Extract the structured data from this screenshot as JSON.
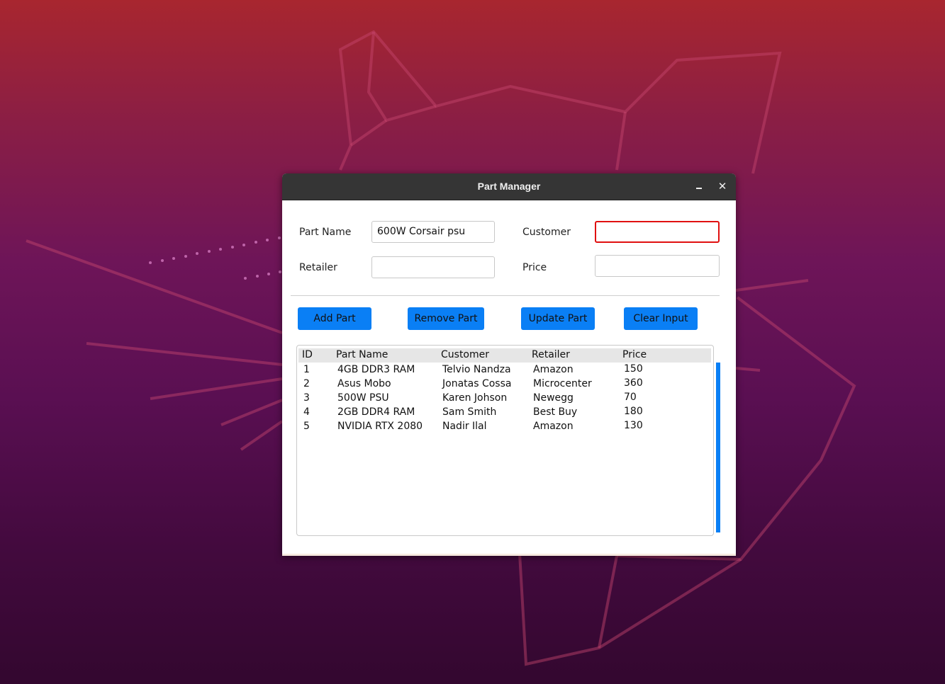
{
  "window": {
    "title": "Part Manager",
    "minimize_glyph": "_",
    "close_glyph": "✕"
  },
  "form": {
    "part_name": {
      "label": "Part Name",
      "value": "600W Corsair psu"
    },
    "customer": {
      "label": "Customer",
      "value": "",
      "error": true,
      "error_color": "#e01010"
    },
    "retailer": {
      "label": "Retailer",
      "value": ""
    },
    "price": {
      "label": "Price",
      "value": ""
    }
  },
  "buttons": {
    "add": "Add Part",
    "remove": "Remove Part",
    "update": "Update Part",
    "clear": "Clear Input",
    "color": "#0a7ff5"
  },
  "table": {
    "columns": [
      "ID",
      "Part Name",
      "Customer",
      "Retailer",
      "Price"
    ],
    "rows": [
      [
        "1",
        "4GB DDR3 RAM",
        "Telvio Nandza",
        "Amazon",
        "150"
      ],
      [
        "2",
        "Asus Mobo",
        "Jonatas Cossa",
        "Microcenter",
        "360"
      ],
      [
        "3",
        "500W PSU",
        "Karen Johson",
        "Newegg",
        "70"
      ],
      [
        "4",
        "2GB DDR4 RAM",
        "Sam Smith",
        "Best Buy",
        "180"
      ],
      [
        "5",
        "NVIDIA RTX 2080",
        "Nadir Ilal",
        "Amazon",
        "130"
      ]
    ]
  }
}
